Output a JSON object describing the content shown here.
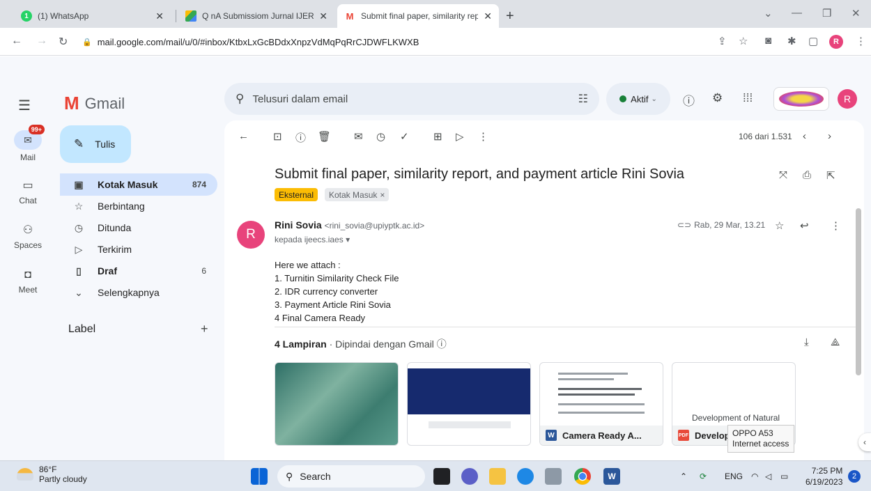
{
  "browser": {
    "tabs": [
      {
        "title": "(1) WhatsApp",
        "favicon": "whatsapp-icon",
        "color": "#25d366",
        "badge": "1"
      },
      {
        "title": "Q nA Submissiom Jurnal IJERE-p",
        "favicon": "drive-icon",
        "color": "#fbbc04"
      },
      {
        "title": "Submit final paper, similarity rep",
        "favicon": "gmail-icon",
        "color": "#ea4335"
      }
    ],
    "url": "mail.google.com/mail/u/0/#inbox/KtbxLxGcBDdxXnpzVdMqPqRrCJDWFLKWXB",
    "profile_initial": "R"
  },
  "gmail": {
    "app_name": "Gmail",
    "search_placeholder": "Telusuri dalam email",
    "status": "Aktif",
    "account_initial": "R",
    "rail": [
      {
        "label": "Mail",
        "badge": "99+",
        "icon": "mail-icon"
      },
      {
        "label": "Chat",
        "icon": "chat-icon"
      },
      {
        "label": "Spaces",
        "icon": "spaces-icon"
      },
      {
        "label": "Meet",
        "icon": "meet-icon"
      }
    ],
    "compose_label": "Tulis",
    "nav": [
      {
        "label": "Kotak Masuk",
        "count": "874",
        "icon": "inbox-icon"
      },
      {
        "label": "Berbintang",
        "count": "",
        "icon": "star-icon"
      },
      {
        "label": "Ditunda",
        "count": "",
        "icon": "snooze-icon"
      },
      {
        "label": "Terkirim",
        "count": "",
        "icon": "sent-icon"
      },
      {
        "label": "Draf",
        "count": "6",
        "icon": "draft-icon"
      },
      {
        "label": "Selengkapnya",
        "count": "",
        "icon": "chevron-down-icon"
      }
    ],
    "label_header": "Label",
    "pager": "106 dari 1.531",
    "message": {
      "subject": "Submit final paper, similarity report, and payment article Rini Sovia",
      "tag_external": "Eksternal",
      "tag_inbox": "Kotak Masuk",
      "sender_initial": "R",
      "sender_name": "Rini Sovia",
      "sender_email": "<rini_sovia@upiyptk.ac.id>",
      "to": "kepada ijeecs.iaes",
      "date": "Rab, 29 Mar, 13.21",
      "body": [
        "Here we attach :",
        "1. Turnitin Similarity Check File",
        "2. IDR currency converter",
        "3. Payment Article Rini Sovia",
        "4 Final Camera Ready"
      ],
      "attachments_count": "4 Lampiran",
      "attachments_scan": "Dipindai dengan Gmail",
      "attachments": [
        {
          "name": "",
          "type": ""
        },
        {
          "name": "",
          "type": ""
        },
        {
          "name": "Camera Ready A...",
          "type": "W",
          "color": "#2b579a"
        },
        {
          "name": "Develop",
          "type": "PDF",
          "color": "#e84a3a",
          "preview_text": "Development of Natural"
        }
      ]
    }
  },
  "tooltip": {
    "line1": "OPPO A53",
    "line2": "Internet access"
  },
  "taskbar": {
    "temperature": "86°F",
    "condition": "Partly cloudy",
    "search_label": "Search",
    "language": "ENG",
    "time": "7:25 PM",
    "date": "6/19/2023",
    "notifications": "2"
  }
}
